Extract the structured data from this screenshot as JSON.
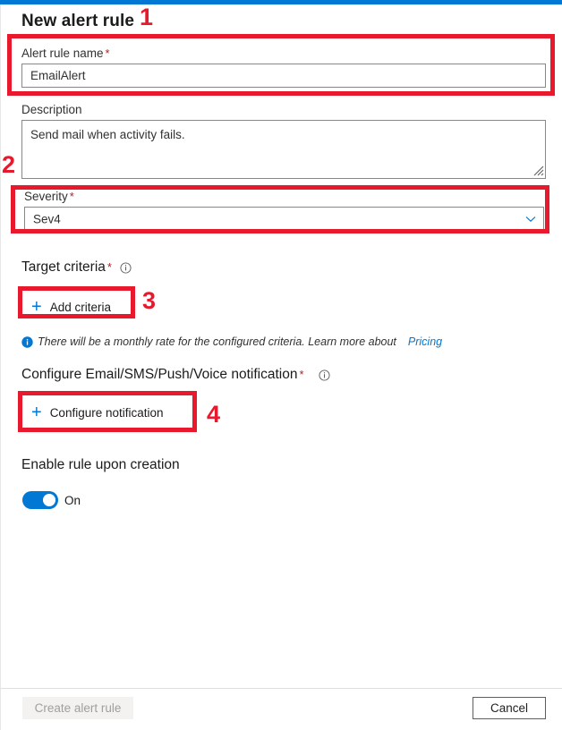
{
  "theme": {
    "accent": "#0078d4",
    "annotation_red": "#e8192c",
    "required_mark_color": "#a4262c",
    "text": "#323130",
    "border": "#8a8886"
  },
  "header": {
    "title": "New alert rule"
  },
  "form": {
    "alert_rule_name": {
      "label": "Alert rule name",
      "required_mark": "*",
      "value": "EmailAlert"
    },
    "description": {
      "label": "Description",
      "value": "Send mail when activity fails."
    },
    "severity": {
      "label": "Severity",
      "required_mark": "*",
      "value": "Sev4",
      "chevron_icon": "chevron-down-icon"
    },
    "target_criteria": {
      "label": "Target criteria",
      "required_mark": "*",
      "info_icon": "info-circle-icon",
      "add_button_label": "Add criteria",
      "add_button_icon": "plus-icon",
      "hint_icon": "info-filled-icon",
      "hint_text": "There will be a monthly rate for the configured criteria. Learn more about",
      "hint_link": "Pricing"
    },
    "notification": {
      "label": "Configure Email/SMS/Push/Voice notification",
      "required_mark": "*",
      "info_icon": "info-circle-icon",
      "configure_button_label": "Configure notification",
      "configure_button_icon": "plus-icon"
    },
    "enable_rule": {
      "label": "Enable rule upon creation",
      "toggle_state": "On",
      "toggle_value_label": "On"
    }
  },
  "footer": {
    "create_label": "Create alert rule",
    "cancel_label": "Cancel"
  },
  "annotations": [
    {
      "number": "1"
    },
    {
      "number": "2"
    },
    {
      "number": "3"
    },
    {
      "number": "4"
    }
  ]
}
